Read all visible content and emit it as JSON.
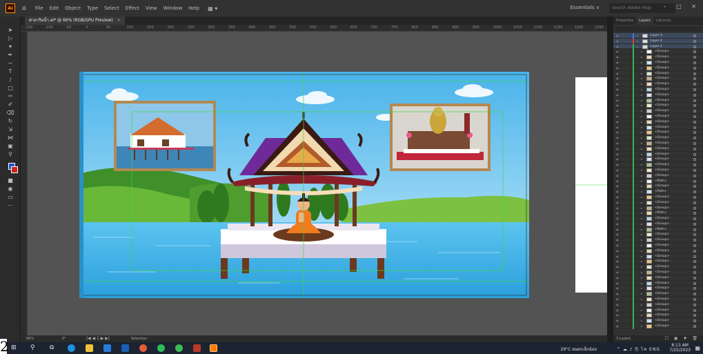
{
  "app": {
    "logo": "Ai"
  },
  "menu": [
    "File",
    "Edit",
    "Object",
    "Type",
    "Select",
    "Effect",
    "View",
    "Window",
    "Help"
  ],
  "workspace": "Essentials ∨",
  "help_search": {
    "placeholder": "Search Adobe Help"
  },
  "window_controls": "– □ ✕",
  "document_tab": {
    "title": "ศาลาริมน้ำ.ai* @ 66% (RGB/GPU Preview)",
    "close": "×"
  },
  "ruler_ticks": [
    "-150",
    "-100",
    "-50",
    "0",
    "50",
    "100",
    "150",
    "200",
    "250",
    "300",
    "350",
    "400",
    "450",
    "500",
    "550",
    "600",
    "650",
    "700",
    "750",
    "800",
    "850",
    "900",
    "950",
    "1000",
    "1050",
    "1100",
    "1150",
    "1200",
    "1250"
  ],
  "status": {
    "zoom": "66%",
    "rotate": "0°",
    "nav": "|◀ ◀ 1 ▶ ▶|",
    "selection": "Selection"
  },
  "layers_panel": {
    "tabs": [
      "Properties",
      "Layers",
      "Libraries"
    ],
    "active_tab": "Layers",
    "layers": [
      {
        "name": "Layer 3",
        "color": "#3c7af0"
      },
      {
        "name": "Layer 2",
        "color": "#e03c3c"
      },
      {
        "name": "Layer 1",
        "color": "#3cb44b"
      }
    ],
    "groups": [
      "<Group>",
      "<Group>",
      "<Group>",
      "<Group>",
      "<Group>",
      "<Group>",
      "<Group>",
      "<Group>",
      "<Group>",
      "<Group>",
      "<Group>",
      "<Group>",
      "<Group>",
      "<Group>",
      "<Group>",
      "<Group>",
      "<Group>",
      "<Group>",
      "<Group>",
      "<Group>",
      "<Group>",
      "<Group>",
      "<Group>",
      "<Group>",
      "<Path>",
      "<Group>",
      "<Path>",
      "<Group>",
      "<Group>",
      "<Group>",
      "<Path>",
      "<Group>",
      "<Group>",
      "<Path>",
      "<Group>",
      "<Group>",
      "<Group>",
      "<Group>",
      "<Group>",
      "<Group>",
      "<Group>",
      "<Group>",
      "<Group>",
      "<Group>",
      "<Group>",
      "<Group>",
      "<Group>",
      "<Group>",
      "<Group>",
      "<Group>",
      "<Group>",
      "<Group>"
    ],
    "footer": "3 Layers"
  },
  "taskbar": {
    "weather": "29°C ฝนตกเล็กน้อย",
    "tray": "^ ☁ ♪ ⎘ ไท ENG",
    "time": "8:13 AM",
    "date": "7/25/2023"
  },
  "corner_digit": "2"
}
